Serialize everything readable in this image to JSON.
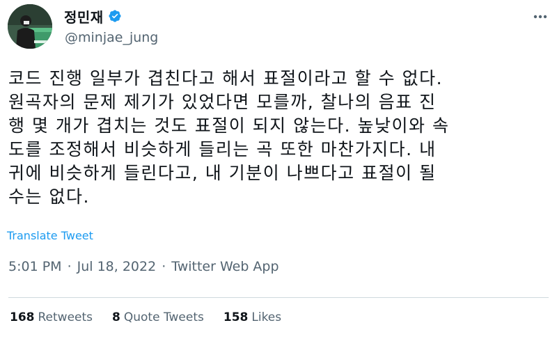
{
  "author": {
    "display_name": "정민재",
    "handle": "@minjae_jung",
    "verified": true,
    "avatar_icon": "profile-photo-icon"
  },
  "tweet": {
    "text": "코드 진행 일부가 겹친다고 해서 표절이라고 할 수 없다.\n원곡자의 문제 제기가 있었다면 모를까, 찰나의 음표 진\n행 몇 개가 겹치는 것도 표절이 되지 않는다. 높낮이와 속\n도를 조정해서 비슷하게 들리는 곡 또한 마찬가지다. 내\n귀에 비슷하게 들린다고, 내 기분이 나쁘다고 표절이 될\n수는 없다.",
    "translate_label": "Translate Tweet"
  },
  "meta": {
    "time": "5:01 PM",
    "separator": "·",
    "date": "Jul 18, 2022",
    "source": "Twitter Web App"
  },
  "stats": {
    "retweets_count": "168",
    "retweets_label": "Retweets",
    "quotes_count": "8",
    "quotes_label": "Quote Tweets",
    "likes_count": "158",
    "likes_label": "Likes"
  },
  "colors": {
    "link": "#1d9bf0",
    "secondary_text": "#536471",
    "primary_text": "#0f1419",
    "verified": "#1d9bf0"
  },
  "icons": {
    "verified": "verified-badge-icon",
    "more": "more-options-icon"
  }
}
